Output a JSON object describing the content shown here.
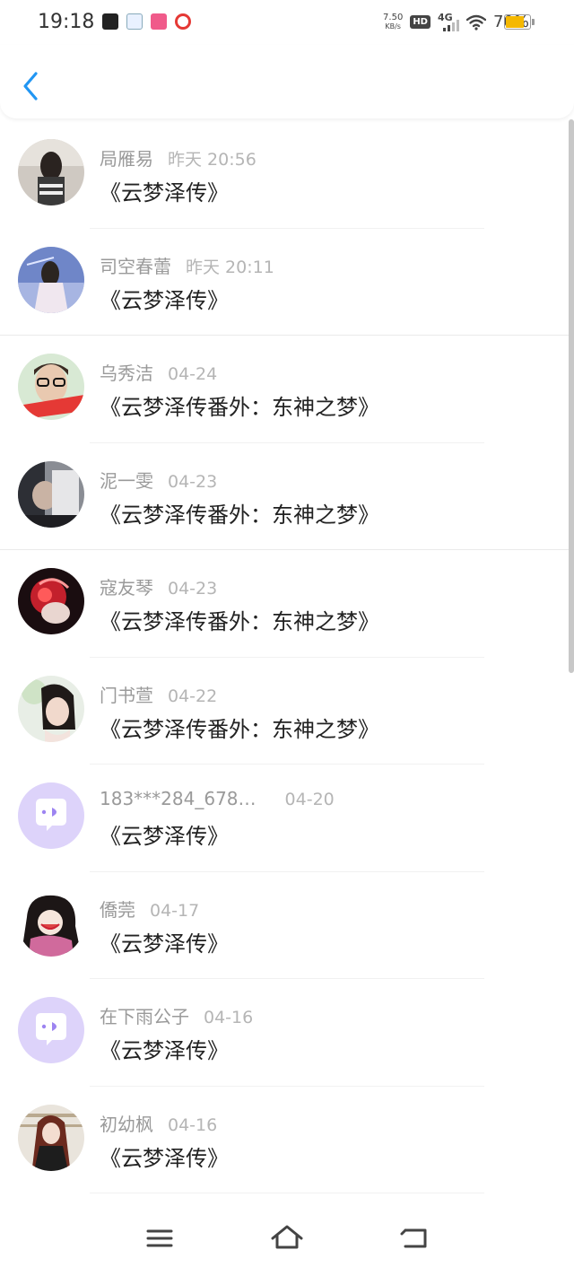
{
  "status": {
    "time": "19:18",
    "net_speed_value": "7.50",
    "net_speed_unit": "KB/s",
    "hd": "HD",
    "network": "4G",
    "battery": "70%"
  },
  "comments": [
    {
      "name": "局雁易",
      "time": "昨天 20:56",
      "title": "《云梦泽传》"
    },
    {
      "name": "司空春蕾",
      "time": "昨天 20:11",
      "title": "《云梦泽传》"
    },
    {
      "name": "乌秀洁",
      "time": "04-24",
      "title": "《云梦泽传番外：东神之梦》"
    },
    {
      "name": "泥一雯",
      "time": "04-23",
      "title": "《云梦泽传番外：东神之梦》"
    },
    {
      "name": "寇友琴",
      "time": "04-23",
      "title": "《云梦泽传番外：东神之梦》"
    },
    {
      "name": "门书萱",
      "time": "04-22",
      "title": "《云梦泽传番外：东神之梦》"
    },
    {
      "name": "183***284_678…",
      "time": "04-20",
      "title": "《云梦泽传》"
    },
    {
      "name": "僑莞",
      "time": "04-17",
      "title": "《云梦泽传》"
    },
    {
      "name": "在下雨公子",
      "time": "04-16",
      "title": "《云梦泽传》"
    },
    {
      "name": "初幼枫",
      "time": "04-16",
      "title": "《云梦泽传》"
    }
  ],
  "icons": {
    "back": "chevron-left-icon",
    "menu": "menu-icon",
    "home": "home-icon",
    "return": "return-icon",
    "default_avatar": "chat-bubble-icon"
  },
  "colors": {
    "accent": "#2196f3",
    "default_avatar_bg": "#ddd3fa",
    "default_avatar_fg": "#9d84f1"
  }
}
